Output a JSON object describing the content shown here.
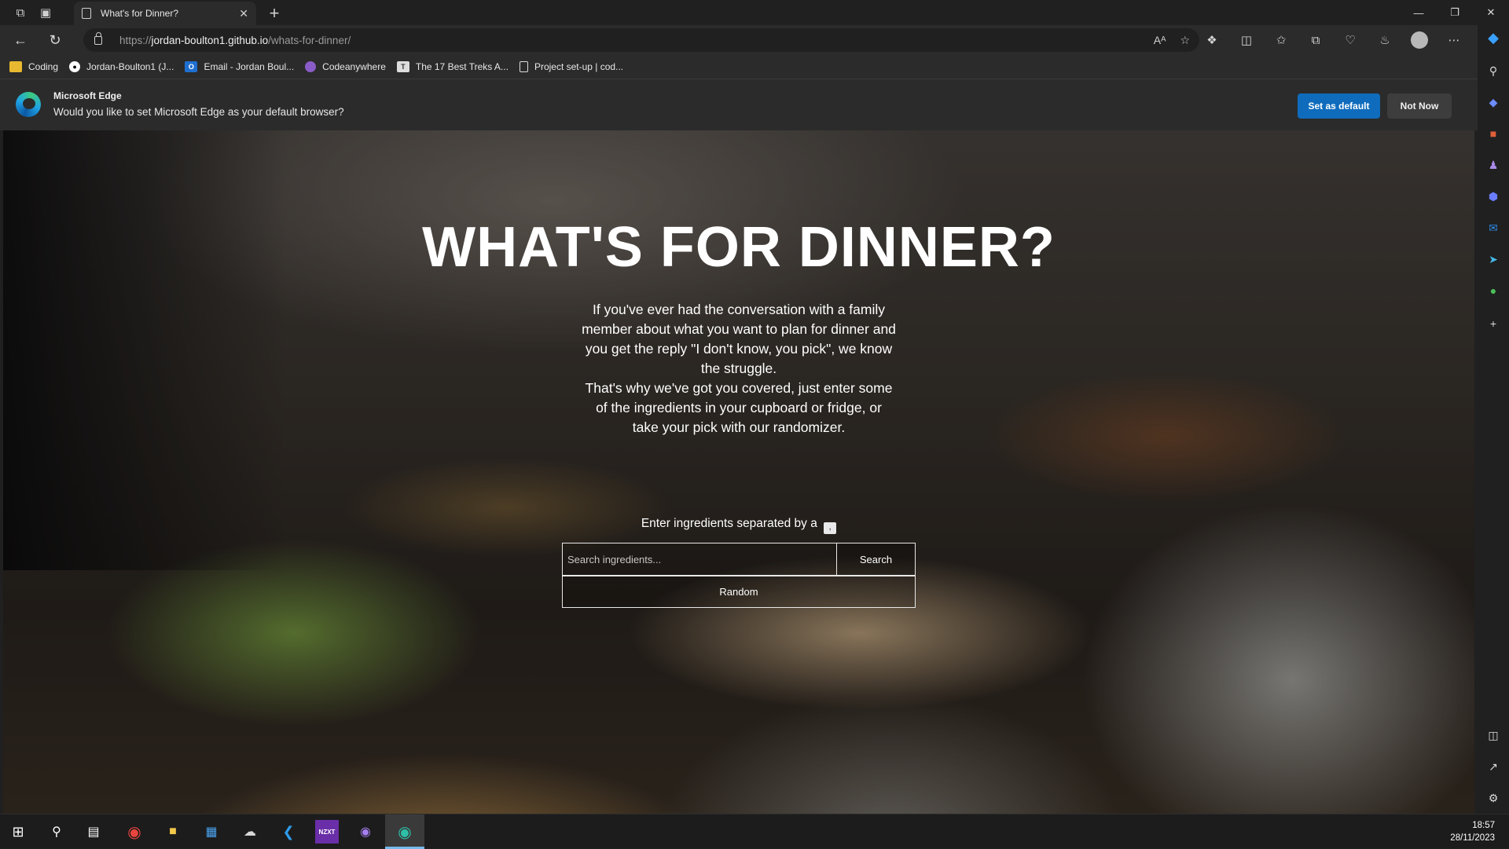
{
  "browser": {
    "tab_title": "What's for Dinner?",
    "url_prefix": "https://",
    "url_host": "jordan-boulton1.github.io",
    "url_path": "/whats-for-dinner/",
    "read_aloud_label": "Aᴬ"
  },
  "favorites": [
    {
      "label": "Coding",
      "icon": "folder-icon",
      "color": "#e8b930"
    },
    {
      "label": "Jordan-Boulton1 (J...",
      "icon": "github-icon",
      "color": "#ffffff"
    },
    {
      "label": "Email - Jordan Boul...",
      "icon": "outlook-icon",
      "color": "#1f6fd1"
    },
    {
      "label": "Codeanywhere",
      "icon": "codeanywhere-icon",
      "color": "#8a5cc7"
    },
    {
      "label": "The 17 Best Treks A...",
      "icon": "page-icon",
      "color": "#dddddd"
    },
    {
      "label": "Project set-up | cod...",
      "icon": "document-icon",
      "color": "#dddddd"
    }
  ],
  "infobar": {
    "title": "Microsoft Edge",
    "message": "Would you like to set Microsoft Edge as your default browser?",
    "primary_label": "Set as default",
    "secondary_label": "Not Now"
  },
  "page": {
    "title": "WHAT'S FOR DINNER?",
    "intro_lines": [
      "If you've ever had the conversation with a family member about what you want to plan for dinner and you get the reply \"I don't know, you pick\", we know the struggle.",
      "That's why we've got you covered, just enter some of the ingredients in your cupboard or fridge, or take your pick with our randomizer."
    ],
    "prompt": "Enter ingredients separated by a",
    "separator": ",",
    "search_placeholder": "Search ingredients...",
    "search_label": "Search",
    "random_label": "Random"
  },
  "taskbar": {
    "time": "18:57",
    "date": "28/11/2023"
  }
}
